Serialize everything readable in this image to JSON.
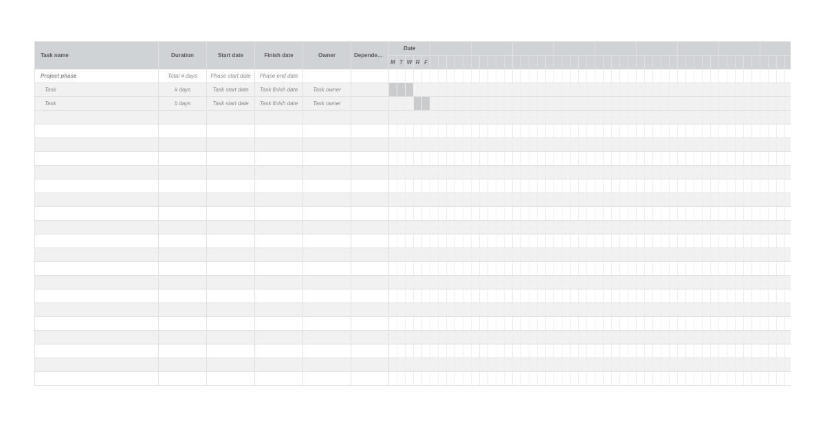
{
  "headers": {
    "task_name": "Task name",
    "duration": "Duration",
    "start_date": "Start date",
    "finish_date": "Finish date",
    "owner": "Owner",
    "dependency": "Dependency",
    "date": "Date"
  },
  "day_labels": [
    "M",
    "T",
    "W",
    "R",
    "F"
  ],
  "weeks": 10,
  "rows": [
    {
      "type": "phase",
      "task_name": "Project phase",
      "duration": "Total # days",
      "start": "Phase start date",
      "finish": "Phase end date",
      "owner": "",
      "dep": "",
      "bar_start": null,
      "bar_len": 0
    },
    {
      "type": "task",
      "task_name": "Task",
      "duration": "# days",
      "start": "Task start date",
      "finish": "Task finish date",
      "owner": "Task owner",
      "dep": "",
      "bar_start": 0,
      "bar_len": 3
    },
    {
      "type": "task",
      "task_name": "Task",
      "duration": "# days",
      "start": "Task start date",
      "finish": "Task finish date",
      "owner": "Task owner",
      "dep": "",
      "bar_start": 3,
      "bar_len": 2
    }
  ],
  "blank_rows": 20
}
